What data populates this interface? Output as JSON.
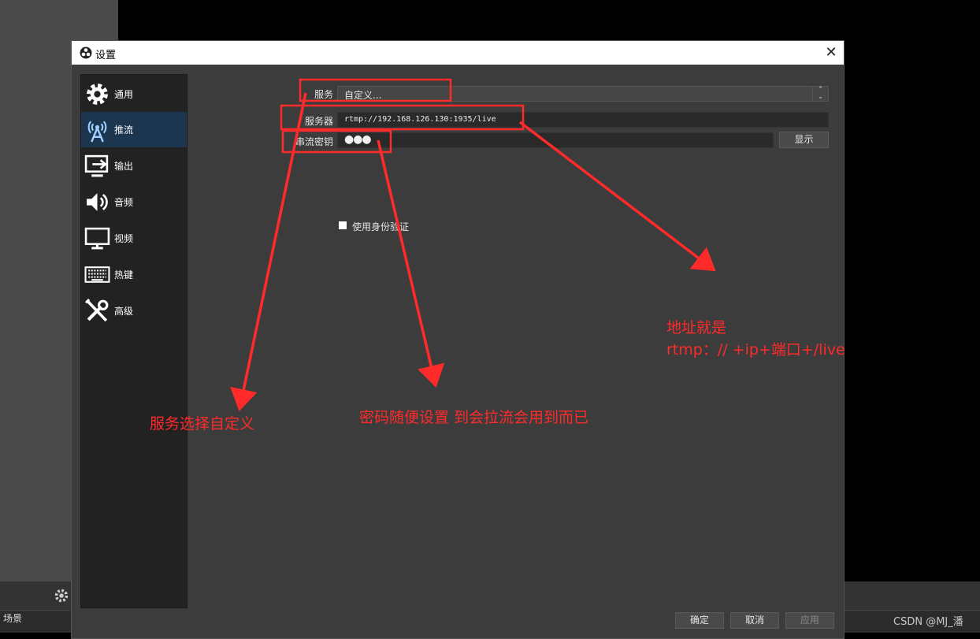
{
  "dialog": {
    "title": "设置",
    "close_symbol": "✕"
  },
  "sidebar": {
    "items": [
      {
        "label": "通用"
      },
      {
        "label": "推流"
      },
      {
        "label": "输出"
      },
      {
        "label": "音频"
      },
      {
        "label": "视频"
      },
      {
        "label": "热键"
      },
      {
        "label": "高级"
      }
    ],
    "active_index": 1
  },
  "stream": {
    "service_label": "服务",
    "service_value": "自定义...",
    "server_label": "服务器",
    "server_value": "rtmp://192.168.126.130:1935/live",
    "key_label": "串流密钥",
    "key_value_masked": "●●●",
    "show_label": "显示",
    "auth_label": "使用身份验证"
  },
  "footer": {
    "ok_label": "确定",
    "cancel_label": "取消",
    "apply_label": "应用"
  },
  "background": {
    "scenes_label": "场景",
    "watermark": "CSDN @MJ_潘"
  },
  "annotations": {
    "service_note": "服务选择自定义",
    "key_note": "密码随便设置 到会拉流会用到而已",
    "address_note_line1": "地址就是",
    "address_note_line2": "rtmp：// +ip+端口+/live"
  },
  "colors": {
    "annotation": "#ff2a2a",
    "active_item": "#1d3650",
    "dialog_bg": "#3c3c3c"
  }
}
